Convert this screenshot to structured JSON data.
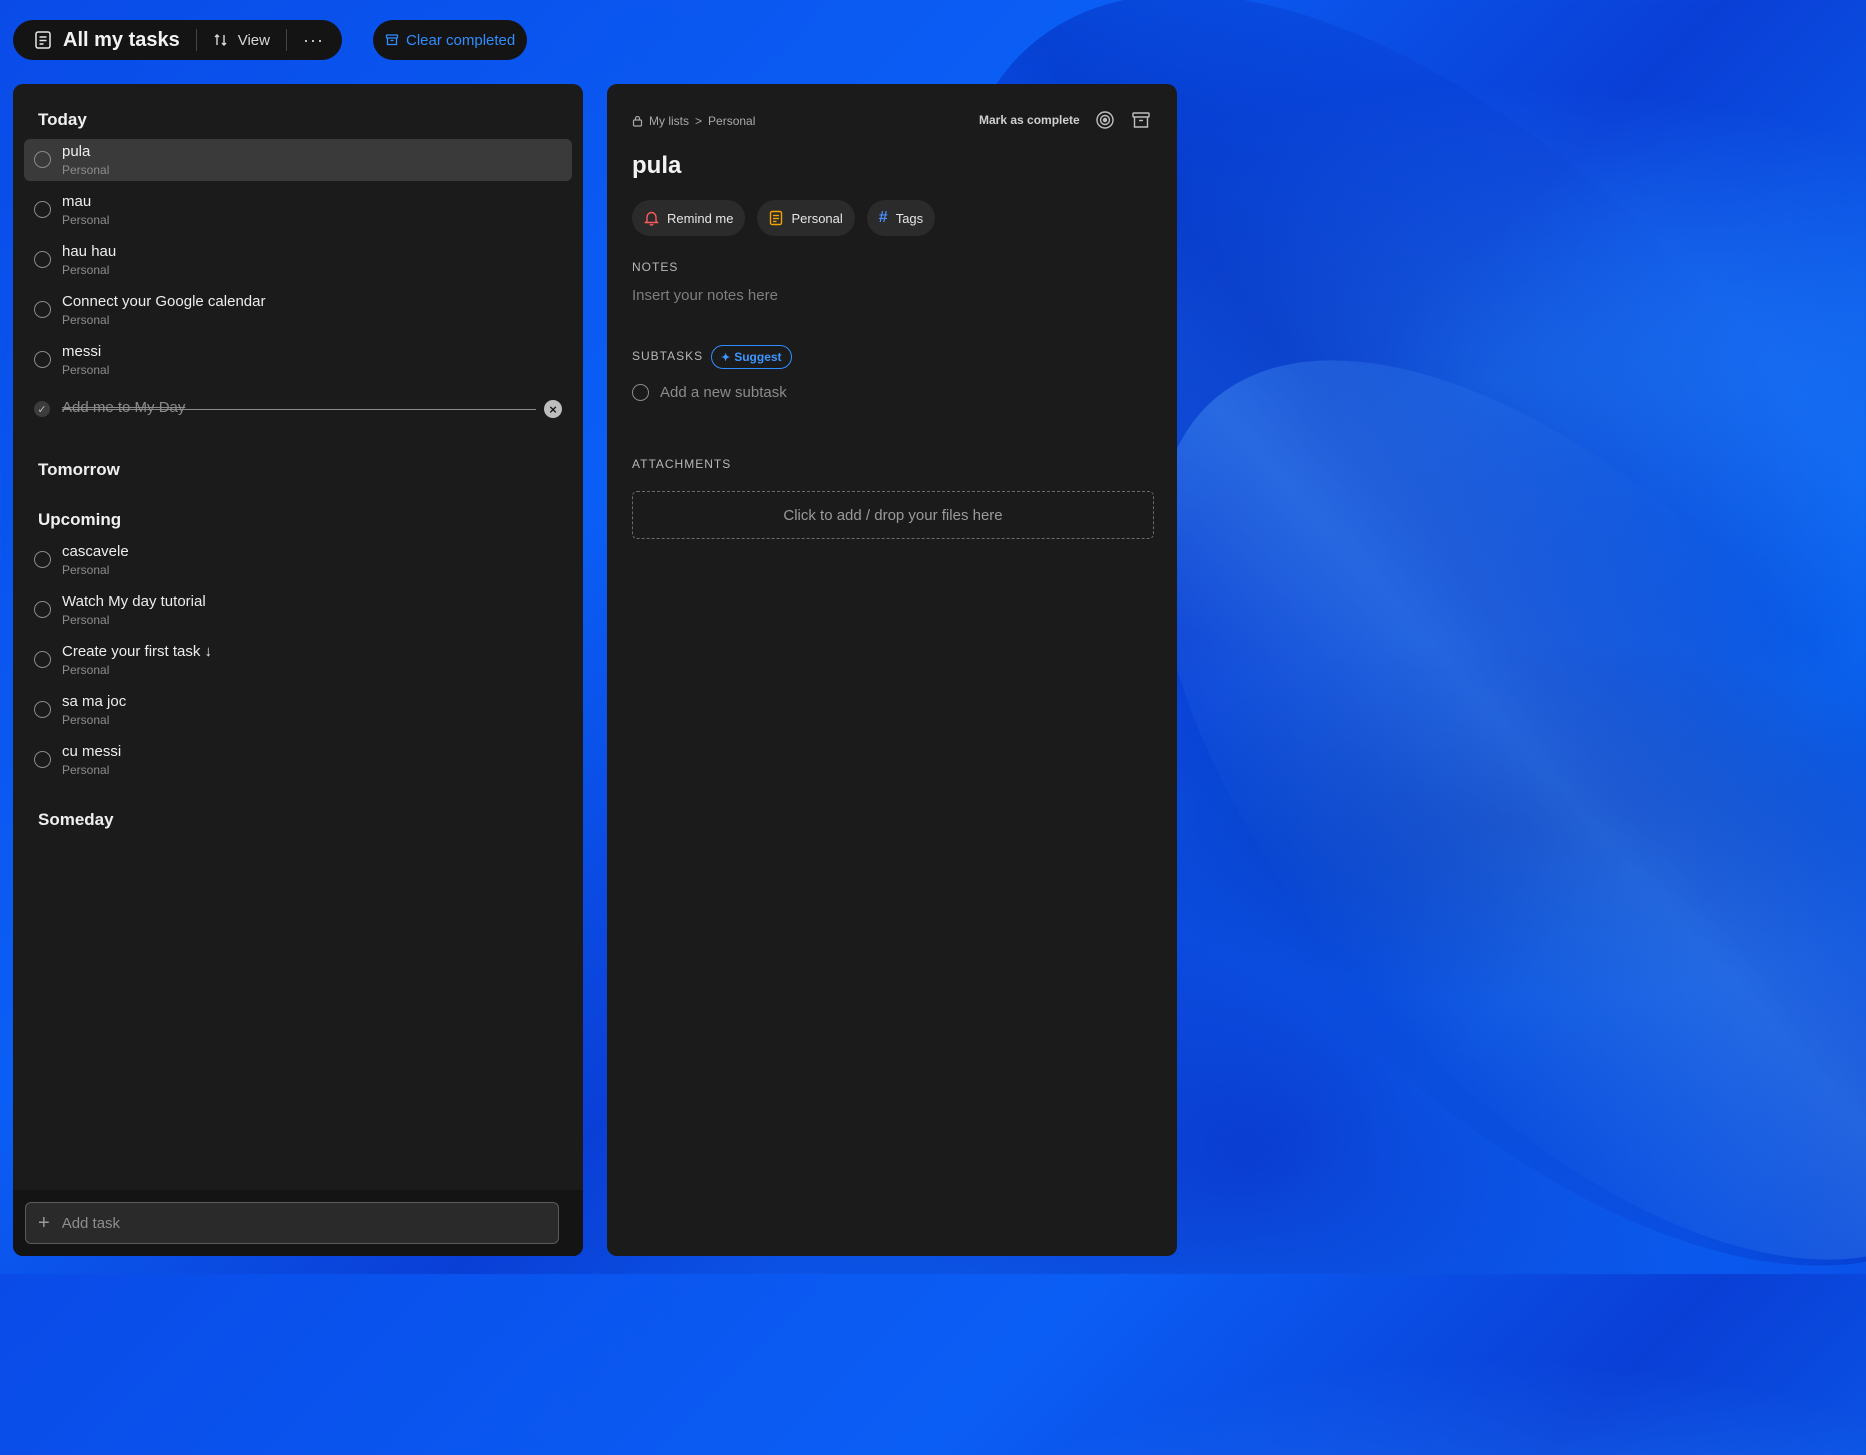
{
  "toolbar": {
    "title": "All my tasks",
    "view_label": "View",
    "more_label": "···",
    "clear_completed_label": "Clear completed"
  },
  "sections": {
    "today": "Today",
    "tomorrow": "Tomorrow",
    "upcoming": "Upcoming",
    "someday": "Someday"
  },
  "today_tasks": [
    {
      "name": "pula",
      "list": "Personal"
    },
    {
      "name": "mau",
      "list": "Personal"
    },
    {
      "name": "hau hau",
      "list": "Personal"
    },
    {
      "name": "Connect your Google calendar",
      "list": "Personal"
    },
    {
      "name": "messi",
      "list": "Personal"
    }
  ],
  "completed_task": {
    "name": "Add me to My Day"
  },
  "upcoming_tasks": [
    {
      "name": "cascavele",
      "list": "Personal"
    },
    {
      "name": "Watch My day tutorial",
      "list": "Personal"
    },
    {
      "name": "Create your first task ↓",
      "list": "Personal"
    },
    {
      "name": "sa ma joc",
      "list": "Personal"
    },
    {
      "name": "cu messi",
      "list": "Personal"
    }
  ],
  "add_task": {
    "placeholder": "Add task"
  },
  "detail": {
    "breadcrumb_root": "My lists",
    "breadcrumb_sep": ">",
    "breadcrumb_list": "Personal",
    "mark_complete_label": "Mark as complete",
    "title": "pula",
    "remind_label": "Remind me",
    "list_label": "Personal",
    "tags_label": "Tags",
    "notes_heading": "NOTES",
    "notes_placeholder": "Insert your notes here",
    "subtasks_heading": "SUBTASKS",
    "suggest_label": "Suggest",
    "subtask_placeholder": "Add a new subtask",
    "attachments_heading": "ATTACHMENTS",
    "dropzone_label": "Click to add / drop your files here"
  },
  "colors": {
    "accent": "#2f8dff",
    "panel_bg": "#1b1b1b",
    "bell": "#ff5a5a",
    "list_icon": "#f0a500",
    "hash": "#4a8dff"
  }
}
